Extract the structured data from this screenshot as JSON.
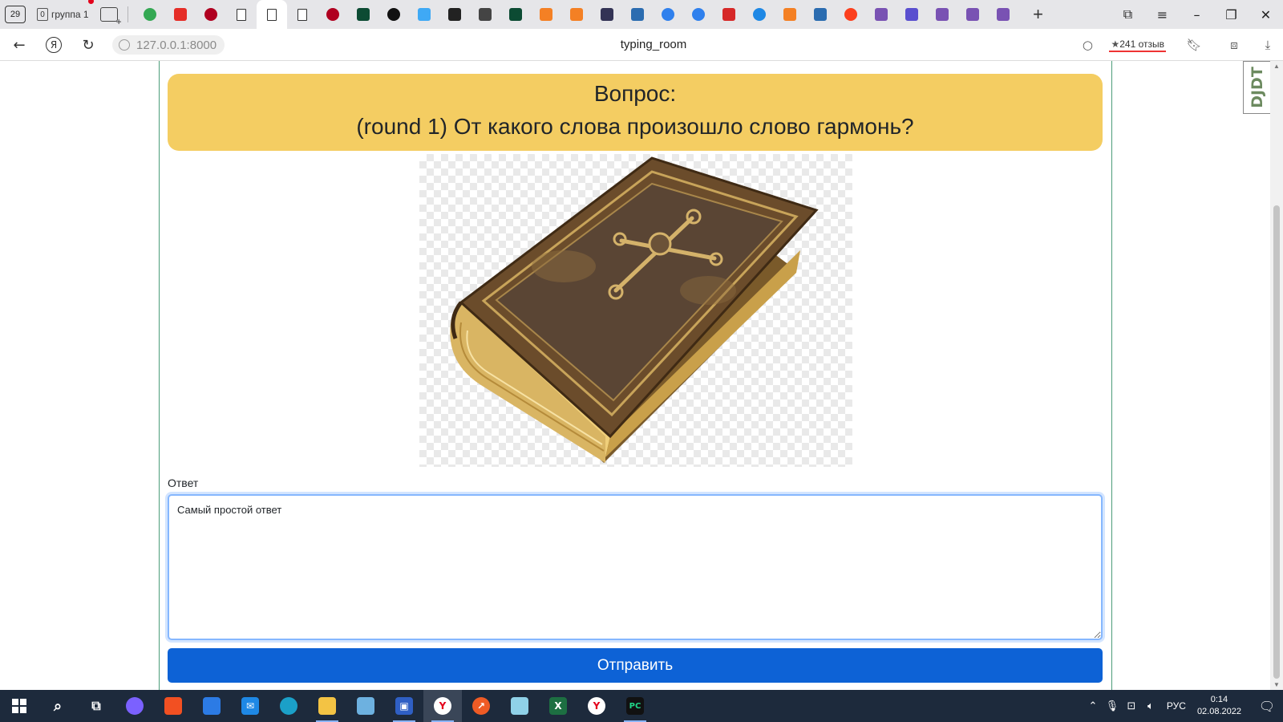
{
  "browser": {
    "tab_counter": "29",
    "group": {
      "count": "0",
      "label": "группа 1"
    },
    "tabs": [
      {
        "icon": "chrome-like-icon",
        "color": "#34a853"
      },
      {
        "icon": "youtube-icon",
        "color": "#e52d27"
      },
      {
        "icon": "red-dots-icon",
        "color": "#b00020"
      },
      {
        "icon": "document-icon",
        "color": "#ffffff"
      },
      {
        "icon": "document-icon",
        "color": "#ffffff",
        "active": true
      },
      {
        "icon": "document-icon",
        "color": "#ffffff"
      },
      {
        "icon": "red-dots-icon",
        "color": "#b00020"
      },
      {
        "icon": "django-icon",
        "color": "#0c4b33"
      },
      {
        "icon": "circle-slash-icon",
        "color": "#111111"
      },
      {
        "icon": "puzzle-icon",
        "color": "#3fa9f5"
      },
      {
        "icon": "hex-icon",
        "color": "#222222"
      },
      {
        "icon": "m-icon",
        "color": "#444444"
      },
      {
        "icon": "django-icon",
        "color": "#0c4b33"
      },
      {
        "icon": "stack-overflow-icon",
        "color": "#f48024"
      },
      {
        "icon": "stack-overflow-icon",
        "color": "#f48024"
      },
      {
        "icon": "frame-icon",
        "color": "#333355"
      },
      {
        "icon": "stack-blue-icon",
        "color": "#2b6cb0"
      },
      {
        "icon": "camera-icon",
        "color": "#2f80ed"
      },
      {
        "icon": "drop-icon",
        "color": "#2f80ed"
      },
      {
        "icon": "umbrella-icon",
        "color": "#d62828"
      },
      {
        "icon": "drops-icon",
        "color": "#1e88e5"
      },
      {
        "icon": "stack-overflow-icon",
        "color": "#f48024"
      },
      {
        "icon": "stack-blue-icon",
        "color": "#2b6cb0"
      },
      {
        "icon": "yandex-icon",
        "color": "#fc3f1d"
      },
      {
        "icon": "bootstrap-icon",
        "color": "#7952b3"
      },
      {
        "icon": "layers-icon",
        "color": "#5a4fcf"
      },
      {
        "icon": "bootstrap-icon",
        "color": "#7952b3"
      },
      {
        "icon": "bootstrap-icon",
        "color": "#7952b3"
      },
      {
        "icon": "bootstrap-icon",
        "color": "#7952b3"
      }
    ],
    "url": "127.0.0.1:8000",
    "page_title": "typing_room",
    "reviews": "241 отзыв"
  },
  "page": {
    "question_label": "Вопрос:",
    "question_text": "(round 1) От какого слова произошло слово гармонь?",
    "image_alt": "book-image",
    "answer_label": "Ответ",
    "answer_value": "Самый простой ответ",
    "submit_label": "Отправить",
    "debug_toolbar_label": "DJDT"
  },
  "taskbar": {
    "lang": "РУС",
    "time": "0:14",
    "date": "02.08.2022"
  },
  "colors": {
    "question_bg": "#f4cd62",
    "submit_bg": "#0d62d6",
    "card_border": "#4c9d79",
    "focus_ring": "#86b7fe"
  }
}
